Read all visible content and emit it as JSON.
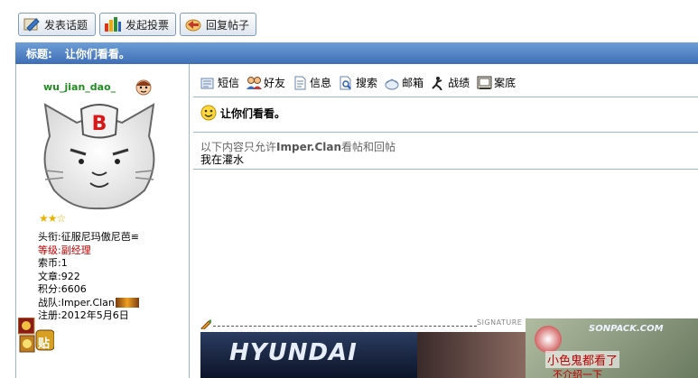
{
  "toolbar": {
    "new_topic": "发表话题",
    "new_poll": "发起投票",
    "reply": "回复帖子"
  },
  "thread": {
    "title_label": "标题:",
    "title": "让你们看看。"
  },
  "user": {
    "name": "wu_jian_dao_",
    "stars": "★★☆",
    "title_label": "头衔:",
    "title_value": "征服尼玛傲尼芭≌",
    "level_label": "等级:",
    "level_value": "副经理",
    "coins_label": "索币:",
    "coins_value": "1",
    "posts_label": "文章:",
    "posts_value": "922",
    "points_label": "积分:",
    "points_value": "6606",
    "team_label": "战队:",
    "team_value": "Imper.Clan",
    "reg_label": "注册:",
    "reg_value": "2012年5月6日",
    "badge_text": "贴"
  },
  "actions": [
    {
      "label": "短信",
      "icon": "message-icon"
    },
    {
      "label": "好友",
      "icon": "friends-icon"
    },
    {
      "label": "信息",
      "icon": "info-icon"
    },
    {
      "label": "搜索",
      "icon": "search-icon"
    },
    {
      "label": "邮箱",
      "icon": "mail-icon"
    },
    {
      "label": "战绩",
      "icon": "stats-icon"
    },
    {
      "label": "案底",
      "icon": "record-icon"
    }
  ],
  "post": {
    "title": "让你们看看。",
    "notice_prefix": "以下内容只允许",
    "notice_team": "Imper.Clan",
    "notice_suffix": "看帖和回帖",
    "body": "我在灌水"
  },
  "signature": {
    "label": "SIGNATURE",
    "image_text": "HYUNDAI"
  },
  "ad": {
    "brand": "SONPACK.COM",
    "caption": "小色鬼都看了",
    "caption2": "不介绍一下"
  }
}
